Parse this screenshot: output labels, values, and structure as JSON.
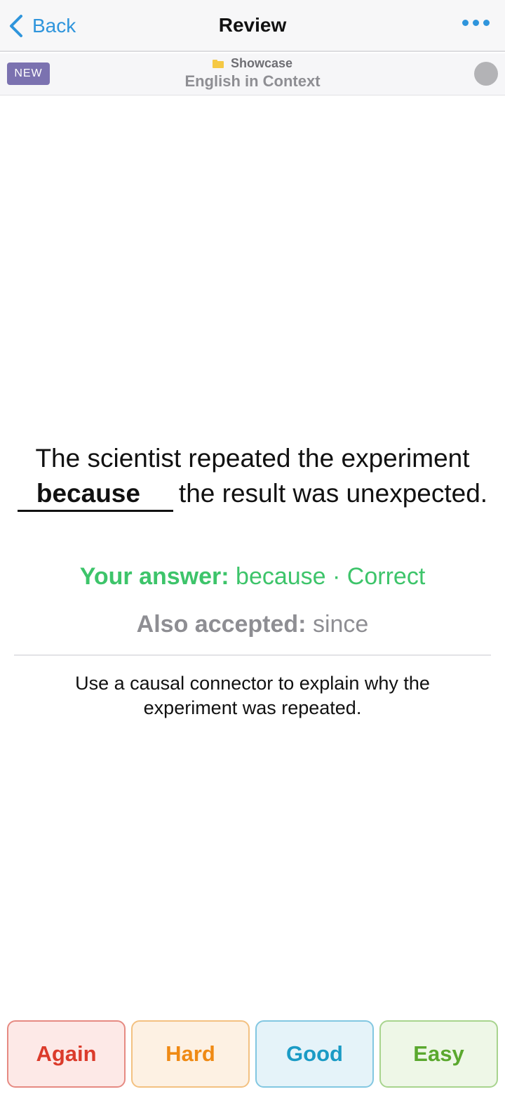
{
  "navbar": {
    "back_label": "Back",
    "title": "Review",
    "more_icon": "ellipsis-icon",
    "accent_color": "#2f95dc"
  },
  "subheader": {
    "badge": "NEW",
    "folder_icon": "folder-icon",
    "folder_name": "Showcase",
    "deck_name": "English in Context"
  },
  "card": {
    "sentence_before": "The scientist repeated the experiment",
    "answer_word": "because",
    "sentence_after": "the result was unexpected.",
    "your_answer_label": "Your answer:",
    "your_answer_value": "because · Correct",
    "also_accepted_label": "Also accepted:",
    "also_accepted_value": "since",
    "hint": "Use a causal connector to explain why the experiment was repeated.",
    "correct_color": "#3dc46a"
  },
  "ratings": {
    "again": "Again",
    "hard": "Hard",
    "good": "Good",
    "easy": "Easy"
  }
}
